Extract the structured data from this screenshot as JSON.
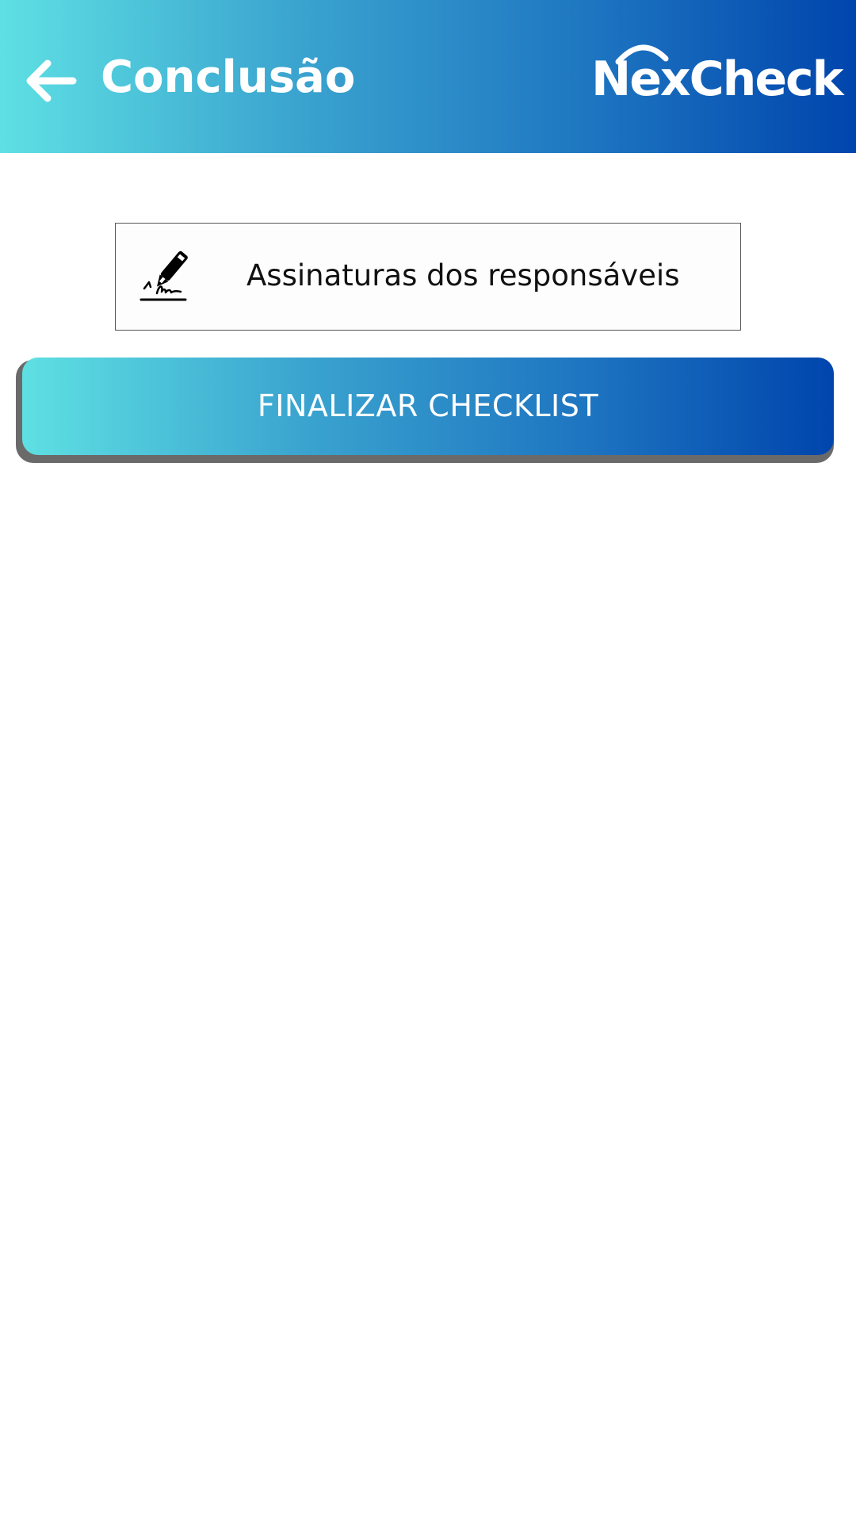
{
  "header": {
    "back_icon": "arrow-left-icon",
    "title": "Conclusão",
    "brand": "NexCheck",
    "gradient_colors": [
      "#5ee0e3",
      "#0045ad"
    ]
  },
  "signatures": {
    "icon": "pen-signature-icon",
    "label": "Assinaturas dos responsáveis"
  },
  "actions": {
    "finish_label": "FINALIZAR CHECKLIST"
  }
}
